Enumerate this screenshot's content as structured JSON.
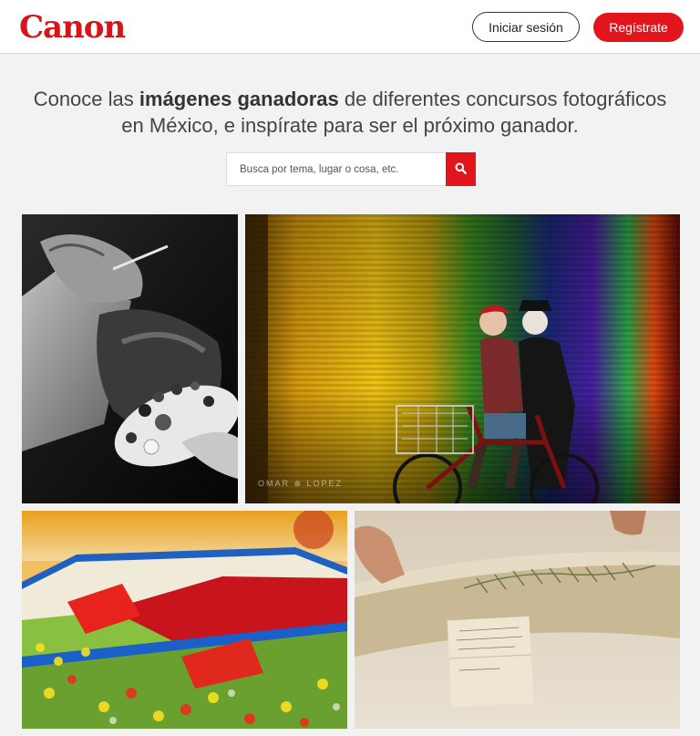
{
  "header": {
    "logo_text": "Canon",
    "login_label": "Iniciar sesión",
    "register_label": "Regístrate"
  },
  "hero": {
    "headline_before": "Conoce las ",
    "headline_bold": "imágenes ganadoras",
    "headline_line1_after": " de diferentes concursos fotográficos",
    "headline_line2": "en México, e inspírate para ser el próximo ganador."
  },
  "search": {
    "placeholder": "Busca por tema, lugar o cosa, etc.",
    "icon": "search-icon"
  },
  "gallery": {
    "photo_bike_watermark": "OMAR ⊗ LOPEZ"
  },
  "colors": {
    "brand_red": "#e2141c",
    "text_dark": "#444444",
    "background": "#f2f2f2"
  }
}
